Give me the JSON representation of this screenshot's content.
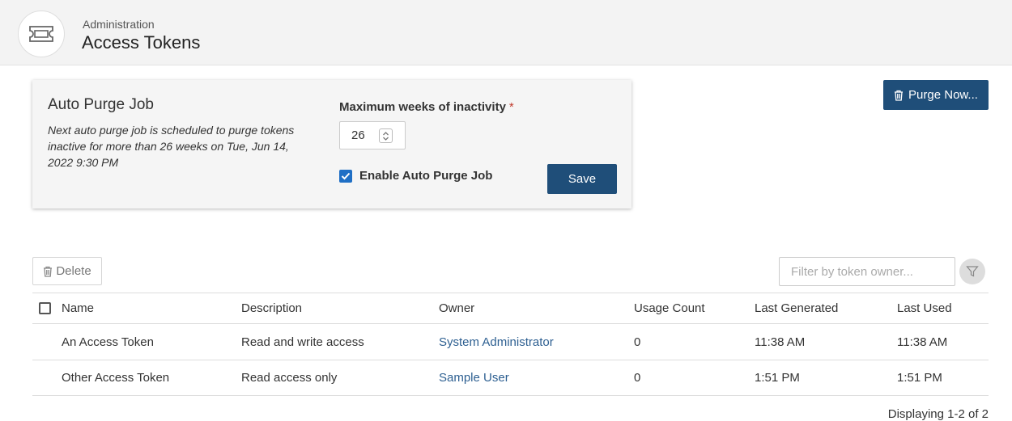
{
  "header": {
    "breadcrumb": "Administration",
    "title": "Access Tokens",
    "icon": "ticket-icon"
  },
  "purge_card": {
    "title": "Auto Purge Job",
    "description": "Next auto purge job is scheduled to purge tokens inactive for more than 26 weeks on Tue, Jun 14, 2022 9:30 PM",
    "max_weeks_label": "Maximum weeks of inactivity",
    "required_marker": "*",
    "max_weeks_value": "26",
    "enable_label": "Enable Auto Purge Job",
    "enable_checked": true,
    "save_label": "Save"
  },
  "purge_now_label": "Purge Now...",
  "toolbar": {
    "delete_label": "Delete",
    "filter_placeholder": "Filter by token owner..."
  },
  "table": {
    "columns": {
      "name": "Name",
      "description": "Description",
      "owner": "Owner",
      "usage_count": "Usage Count",
      "last_generated": "Last Generated",
      "last_used": "Last Used"
    },
    "rows": [
      {
        "name": "An Access Token",
        "description": "Read and write access",
        "owner": "System Administrator",
        "usage_count": "0",
        "last_generated": "11:38 AM",
        "last_used": "11:38 AM"
      },
      {
        "name": "Other Access Token",
        "description": "Read access only",
        "owner": "Sample User",
        "usage_count": "0",
        "last_generated": "1:51 PM",
        "last_used": "1:51 PM"
      }
    ]
  },
  "footer": {
    "displaying": "Displaying 1-2 of 2"
  },
  "colors": {
    "primary_button": "#1f4e79",
    "link": "#2d5f91",
    "checkbox": "#1f6fc5",
    "required": "#c0392b"
  }
}
